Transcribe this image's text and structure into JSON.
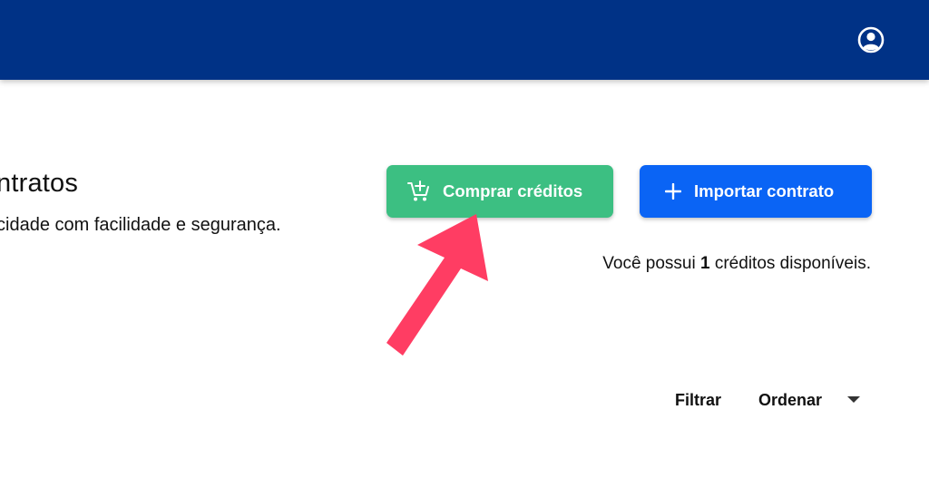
{
  "header": {
    "account_icon": "account-circle-icon",
    "background_color": "#003286"
  },
  "page": {
    "title": "ntratos",
    "subtitle": "cidade com facilidade e segurança."
  },
  "actions": {
    "buy_credits_label": "Comprar créditos",
    "buy_credits_icon": "cart-plus-icon",
    "buy_credits_color": "#3cbf82",
    "import_contract_label": "Importar contrato",
    "import_contract_icon": "plus-icon",
    "import_contract_color": "#0a64f5"
  },
  "credits": {
    "prefix": "Você possui ",
    "count": "1",
    "suffix": " créditos disponíveis."
  },
  "annotation": {
    "arrow_color": "#ff3d63"
  },
  "toolbar": {
    "filter_label": "Filtrar",
    "sort_label": "Ordenar"
  }
}
